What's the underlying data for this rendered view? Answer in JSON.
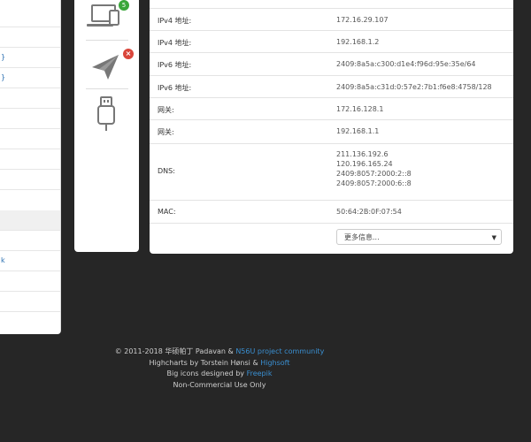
{
  "sidebar": {
    "items": [
      {
        "label": ""
      },
      {
        "label": "}"
      },
      {
        "label": "}"
      },
      {
        "label": ""
      },
      {
        "label": ""
      },
      {
        "label": ""
      },
      {
        "label": ""
      },
      {
        "label": ""
      },
      {
        "label": ""
      },
      {
        "label": ""
      },
      {
        "label": ""
      },
      {
        "label": "k"
      },
      {
        "label": ""
      },
      {
        "label": ""
      },
      {
        "label": ""
      }
    ]
  },
  "icons": {
    "computer_badge": "5",
    "usb_label": ""
  },
  "info": {
    "rows": [
      {
        "label": "IPv4 地址:",
        "value": "172.16.29.107"
      },
      {
        "label": "IPv4 地址:",
        "value": "192.168.1.2"
      },
      {
        "label": "IPv6 地址:",
        "value": "2409:8a5a:c300:d1e4:f96d:95e:35e/64"
      },
      {
        "label": "IPv6 地址:",
        "value": "2409:8a5a:c31d:0:57e2:7b1:f6e8:4758/128"
      },
      {
        "label": "网关:",
        "value": "172.16.128.1"
      },
      {
        "label": "网关:",
        "value": "192.168.1.1"
      }
    ],
    "dns_label": "DNS:",
    "dns_values": [
      "211.136.192.6",
      "120.196.165.24",
      "2409:8057:2000:2::8",
      "2409:8057:2000:6::8"
    ],
    "mac_label": "MAC:",
    "mac_value": "50:64:2B:0F:07:54",
    "more_select": "更多信息..."
  },
  "footer": {
    "line1_prefix": "© 2011-2018 华硕帕丁 Padavan & ",
    "line1_link": "N56U project community",
    "line2_prefix": "Highcharts by Torstein Hønsi & ",
    "line2_link": "Highsoft",
    "line3_prefix": "Big icons designed by ",
    "line3_link": "Freepik",
    "line4": "Non-Commercial Use Only"
  },
  "colors": {
    "background": "#262626",
    "link": "#3a8fd1",
    "badge_green": "#3aa63a",
    "badge_red": "#d9453a"
  }
}
